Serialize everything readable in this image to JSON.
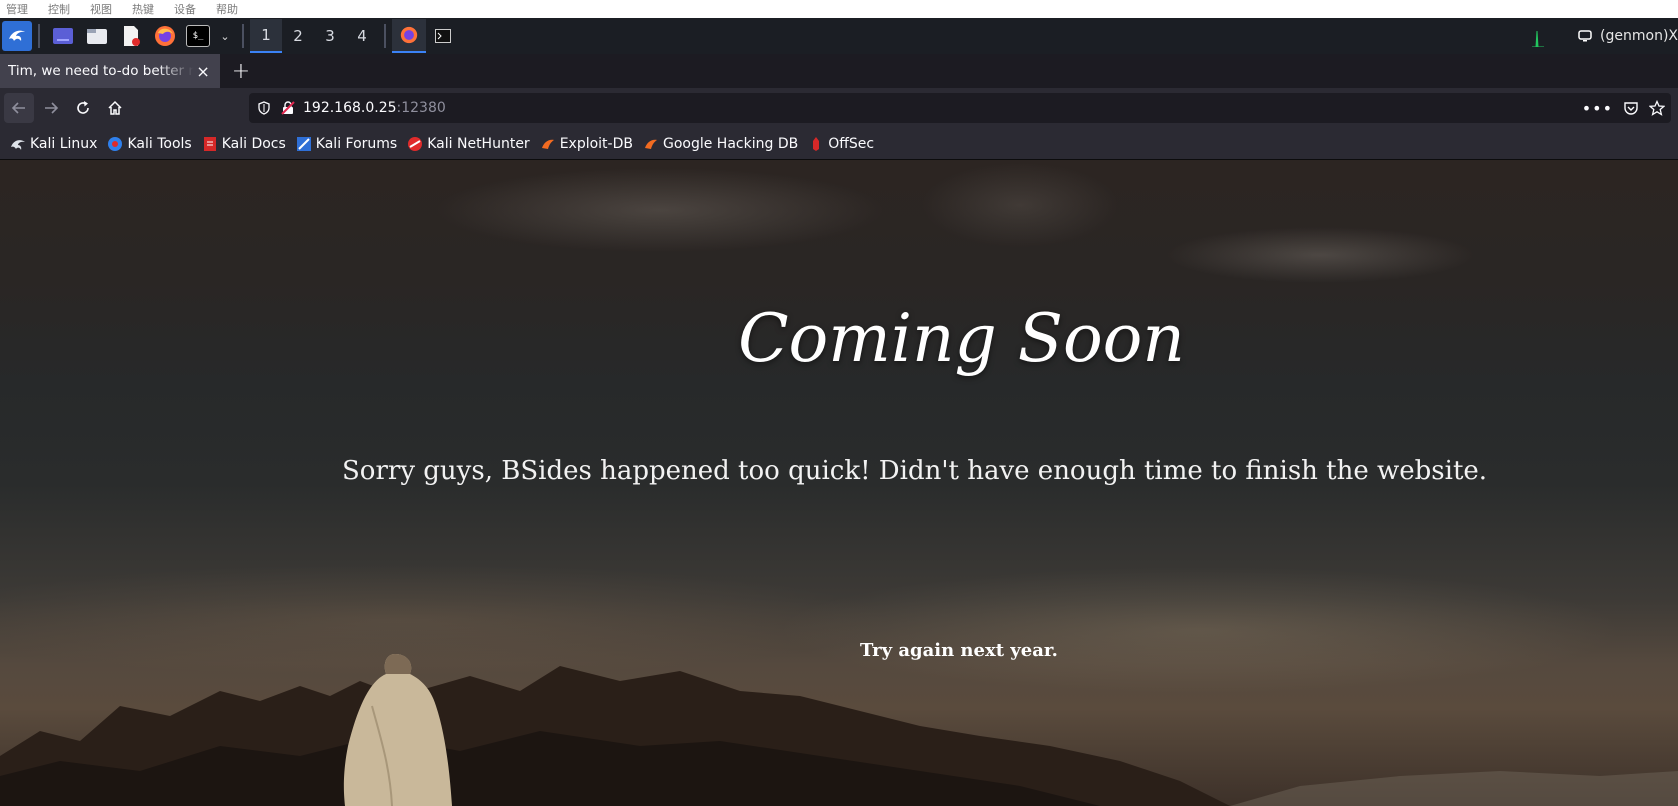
{
  "vm_menu": [
    "管理",
    "控制",
    "视图",
    "热键",
    "设备",
    "帮助"
  ],
  "panel": {
    "workspaces": [
      "1",
      "2",
      "3",
      "4"
    ],
    "active_workspace": "1",
    "genmon": "(genmon)X"
  },
  "tab": {
    "title": "Tim, we need to-do better next year",
    "close": "×"
  },
  "newtab": "+",
  "urlbar": {
    "host": "192.168.0.25",
    "port": ":12380"
  },
  "bookmarks": [
    {
      "label": "Kali Linux",
      "icon": "kali-dragon-icon"
    },
    {
      "label": "Kali Tools",
      "icon": "kali-tools-icon"
    },
    {
      "label": "Kali Docs",
      "icon": "kali-docs-icon"
    },
    {
      "label": "Kali Forums",
      "icon": "kali-forums-icon"
    },
    {
      "label": "Kali NetHunter",
      "icon": "nethunter-icon"
    },
    {
      "label": "Exploit-DB",
      "icon": "exploit-db-icon"
    },
    {
      "label": "Google Hacking DB",
      "icon": "ghdb-icon"
    },
    {
      "label": "OffSec",
      "icon": "offsec-icon"
    }
  ],
  "page": {
    "heading": "Coming Soon",
    "subtitle": "Sorry guys, BSides happened too quick! Didn't have enough time to finish the website.",
    "note": "Try again next year."
  },
  "colors": {
    "accent": "#3b82f6",
    "tab_active": "#42414d",
    "toolbar": "#2b2a33",
    "url_field": "#1c1b22"
  }
}
